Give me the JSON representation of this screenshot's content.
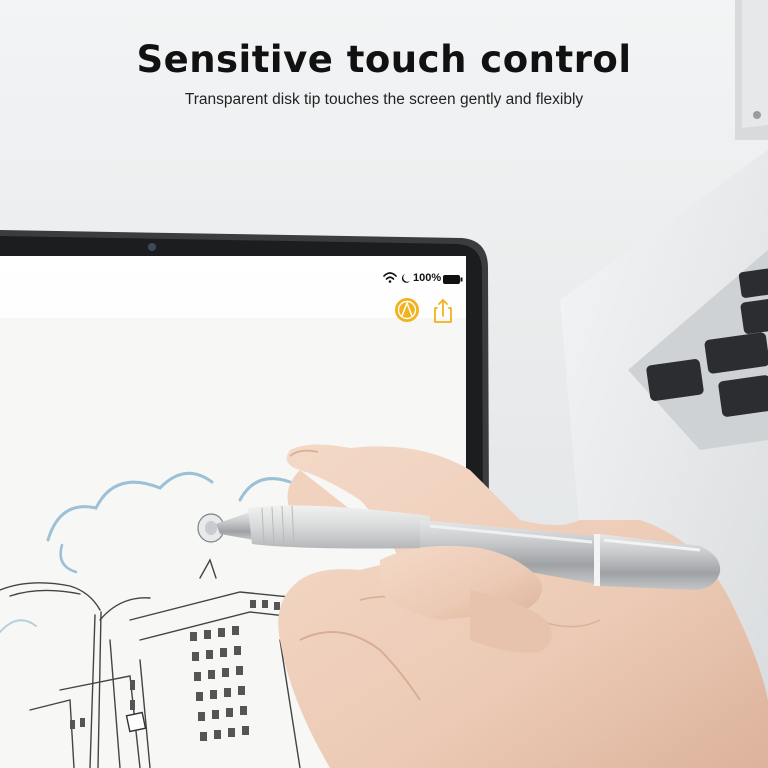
{
  "headline": "Sensitive touch control",
  "subline": "Transparent disk tip touches the screen gently and flexibly",
  "tablet": {
    "battery_label": "100%",
    "status_icons": [
      "wifi-icon",
      "moon-icon",
      "battery-icon"
    ],
    "toolbar_icons": [
      "pen-tool-icon",
      "share-icon"
    ],
    "accent_color": "#f2b21b"
  },
  "colors": {
    "background": "#eceeef",
    "stylus": "#b9bcbf",
    "sketch_blue": "#8fb6cf"
  }
}
